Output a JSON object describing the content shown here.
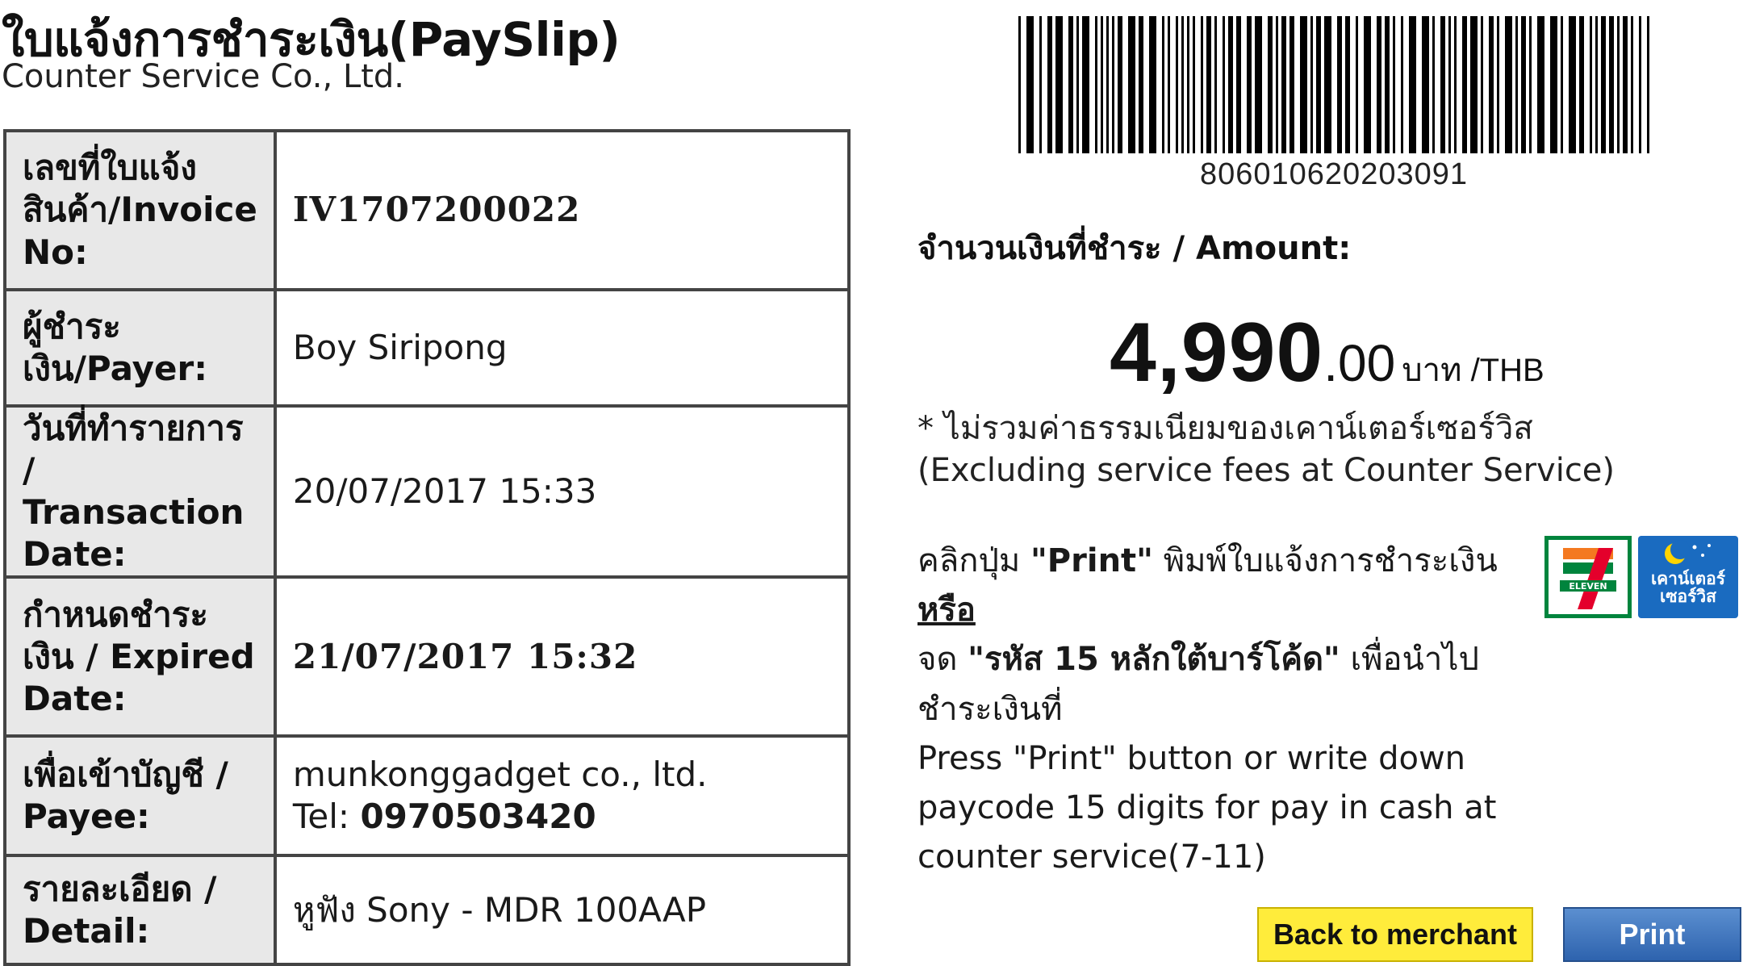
{
  "header": {
    "title": "ใบแจ้งการชำระเงิน(PaySlip)",
    "company": "Counter Service Co., Ltd."
  },
  "info_table": {
    "rows": [
      {
        "label": "เลขที่ใบแจ้งสินค้า/Invoice No:",
        "value": "IV1707200022"
      },
      {
        "label": "ผู้ชำระเงิน/Payer:",
        "value": "Boy Siripong"
      },
      {
        "label": "วันที่ทำรายการ / Transaction Date:",
        "value": "20/07/2017 15:33"
      },
      {
        "label": "กำหนดชำระเงิน / Expired Date:",
        "value": "21/07/2017 15:32"
      },
      {
        "label": "เพื่อเข้าบัญชี / Payee:",
        "value": "munkonggadget co., ltd.",
        "tel_label": "Tel:",
        "tel_value": "0970503420"
      },
      {
        "label": "รายละเอียด / Detail:",
        "value": "หูฟัง Sony - MDR 100AAP"
      }
    ]
  },
  "barcode": {
    "number": "806010620203091"
  },
  "amount": {
    "label": "จำนวนเงินที่ชำระ / Amount:",
    "integer": "4,990",
    "decimal": ".00",
    "unit": "บาท /THB"
  },
  "note": {
    "thai": "* ไม่รวมค่าธรรมเนียมของเคาน์เตอร์เซอร์วิส",
    "english": "(Excluding service fees at Counter Service)"
  },
  "instructions": {
    "part1": "คลิกปุ่ม",
    "print_quote": "\"Print\"",
    "part2": "พิมพ์ใบแจ้งการชำระเงิน",
    "or": "หรือ",
    "part3": "จด",
    "code_quote": "\"รหัส 15 หลักใต้บาร์โค้ด\"",
    "part4": "เพื่อนำไป",
    "part5": "ชำระเงินที่",
    "en_line1": "Press \"Print\" button or write down",
    "en_line2": "paycode 15 digits for pay in cash at",
    "en_line3": "counter service(7-11)"
  },
  "logos": {
    "seven_eleven": {
      "text": "ELEVEN",
      "icon": "seven-eleven-logo"
    },
    "counter_service": {
      "text_line1": "เคาน์เตอร์",
      "text_line2": "เซอร์วิส",
      "icon": "counter-service-logo"
    }
  },
  "buttons": {
    "back": "Back to merchant",
    "print": "Print"
  },
  "colors": {
    "back_button": "#ffec3b",
    "print_button": "#2e63ae",
    "seven_eleven_green": "#00843d",
    "seven_eleven_orange": "#f47920",
    "seven_eleven_red": "#e4002b",
    "counter_service_blue": "#1a6bc0"
  }
}
